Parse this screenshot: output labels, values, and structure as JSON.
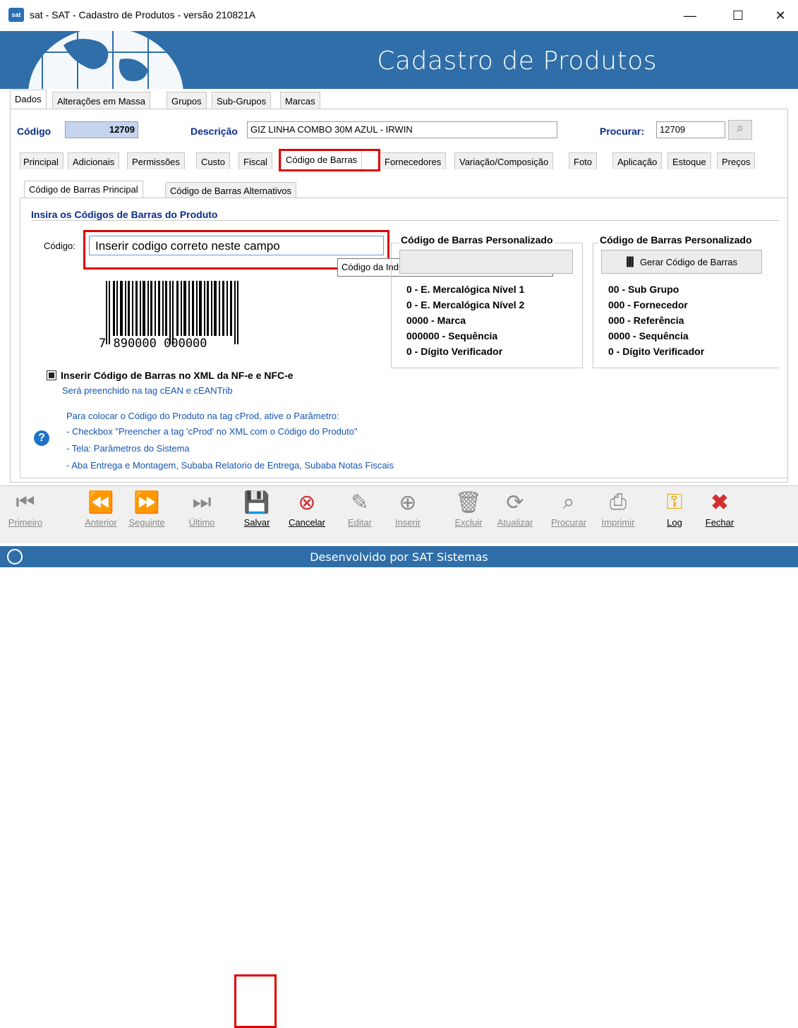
{
  "window": {
    "title": "sat - SAT - Cadastro de Produtos - versão 210821A",
    "app_icon": "sat",
    "min": "—",
    "max": "☐",
    "close": "✕"
  },
  "banner": {
    "title": "Cadastro de Produtos"
  },
  "top_tabs": [
    "Dados",
    "Alterações em Massa",
    "Grupos",
    "Sub-Grupos",
    "Marcas"
  ],
  "record": {
    "codigo_label": "Código",
    "codigo_value": "12709",
    "descricao_label": "Descrição",
    "descricao_value": "GIZ LINHA COMBO 30M AZUL - IRWIN",
    "procurar_label": "Procurar:",
    "procurar_value": "12709"
  },
  "detail_tabs": [
    "Principal",
    "Adicionais",
    "Permissões",
    "Custo",
    "Fiscal",
    "Código de Barras",
    "Fornecedores",
    "Variação/Composição",
    "Foto",
    "Aplicação",
    "Estoque",
    "Preços"
  ],
  "barcode_tabs": [
    "Código de Barras Principal",
    "Código de Barras Alternativos"
  ],
  "barcode": {
    "section_title": "Insira os Códigos de Barras do Produto",
    "codigo_label": "Código:",
    "codigo_value": "Inserir codigo correto neste campo",
    "tooltip": "Código da Indústria ou Código de Barra",
    "barcode_digits": "7 890000 000000",
    "col1_title": "Código de Barras Personalizado",
    "col1_lines": [
      "0 - E. Mercalógica Nível 1",
      "0 - E. Mercalógica Nível 2",
      "0000 - Marca",
      "000000 - Sequência",
      "0 - Dígito Verificador"
    ],
    "col2_title": "Código de Barras Personalizado",
    "col2_button": "Gerar Código de Barras",
    "col2_lines": [
      "00 - Sub Grupo",
      "000 - Fornecedor",
      "000 - Referência",
      "0000 - Sequência",
      "0 - Dígito Verificador"
    ],
    "xml_checkbox_label": "Inserir Código de Barras no XML da NF-e e NFC-e",
    "xml_note": "Será preenchido na tag cEAN e cEANTrib",
    "help_lines": [
      "Para colocar o Código do Produto na tag cProd, ative o Parâmetro:",
      "- Checkbox \"Preencher a tag 'cProd' no XML com o Código do Produto\"",
      "- Tela: Parâmetros do Sistema",
      "- Aba Entrega e Montagem, Subaba Relatorio de Entrega, Subaba Notas Fiscais"
    ]
  },
  "toolbar": {
    "primeiro": "Primeiro",
    "anterior": "Anterior",
    "seguinte": "Seguinte",
    "ultimo": "Último",
    "salvar": "Salvar",
    "cancelar": "Cancelar",
    "editar": "Editar",
    "inserir": "Inserir",
    "excluir": "Excluir",
    "atualizar": "Atualizar",
    "procurar": "Procurar",
    "imprimir": "Imprimir",
    "log": "Log",
    "fechar": "Fechar"
  },
  "status": {
    "text": "Desenvolvido por SAT Sistemas"
  },
  "colors": {
    "banner": "#2f6ea8",
    "highlight": "#e00000",
    "label_blue": "#0a2d8a",
    "note_blue": "#1555b3"
  }
}
